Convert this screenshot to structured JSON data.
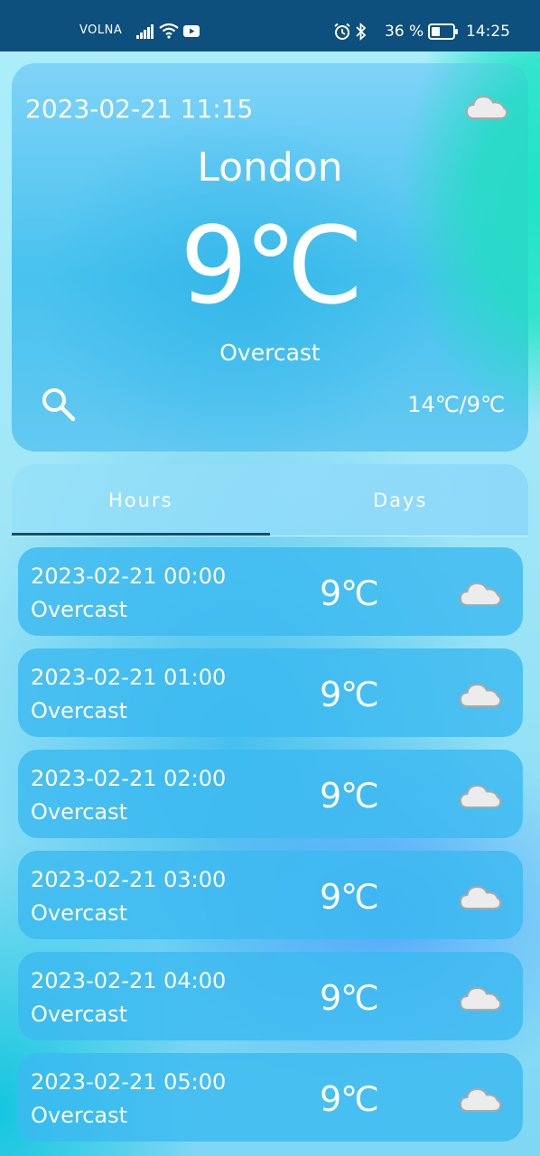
{
  "status_bar": {
    "carrier": "VOLNA",
    "battery_percent": "36 %",
    "time": "14:25",
    "icons": [
      "signal-icon",
      "wifi-icon",
      "youtube-icon",
      "alarm-icon",
      "bluetooth-icon",
      "battery-icon"
    ]
  },
  "current": {
    "datetime": "2023-02-21 11:15",
    "city": "London",
    "temperature": "9℃",
    "condition": "Overcast",
    "range": "14℃/9℃",
    "icon": "cloud-icon"
  },
  "tabs": [
    {
      "label": "Hours",
      "selected": true
    },
    {
      "label": "Days",
      "selected": false
    }
  ],
  "hours": [
    {
      "time": "2023-02-21 00:00",
      "condition": "Overcast",
      "temp": "9℃",
      "icon": "cloud-icon"
    },
    {
      "time": "2023-02-21 01:00",
      "condition": "Overcast",
      "temp": "9℃",
      "icon": "cloud-icon"
    },
    {
      "time": "2023-02-21 02:00",
      "condition": "Overcast",
      "temp": "9℃",
      "icon": "cloud-icon"
    },
    {
      "time": "2023-02-21 03:00",
      "condition": "Overcast",
      "temp": "9℃",
      "icon": "cloud-icon"
    },
    {
      "time": "2023-02-21 04:00",
      "condition": "Overcast",
      "temp": "9℃",
      "icon": "cloud-icon"
    },
    {
      "time": "2023-02-21 05:00",
      "condition": "Overcast",
      "temp": "9℃",
      "icon": "cloud-icon"
    }
  ],
  "colors": {
    "status_bar": "#0d4f7d",
    "tab_indicator": "#0d4f7d",
    "accent_teal": "#1fe3c7",
    "card_blue": "#3cb9f0"
  }
}
